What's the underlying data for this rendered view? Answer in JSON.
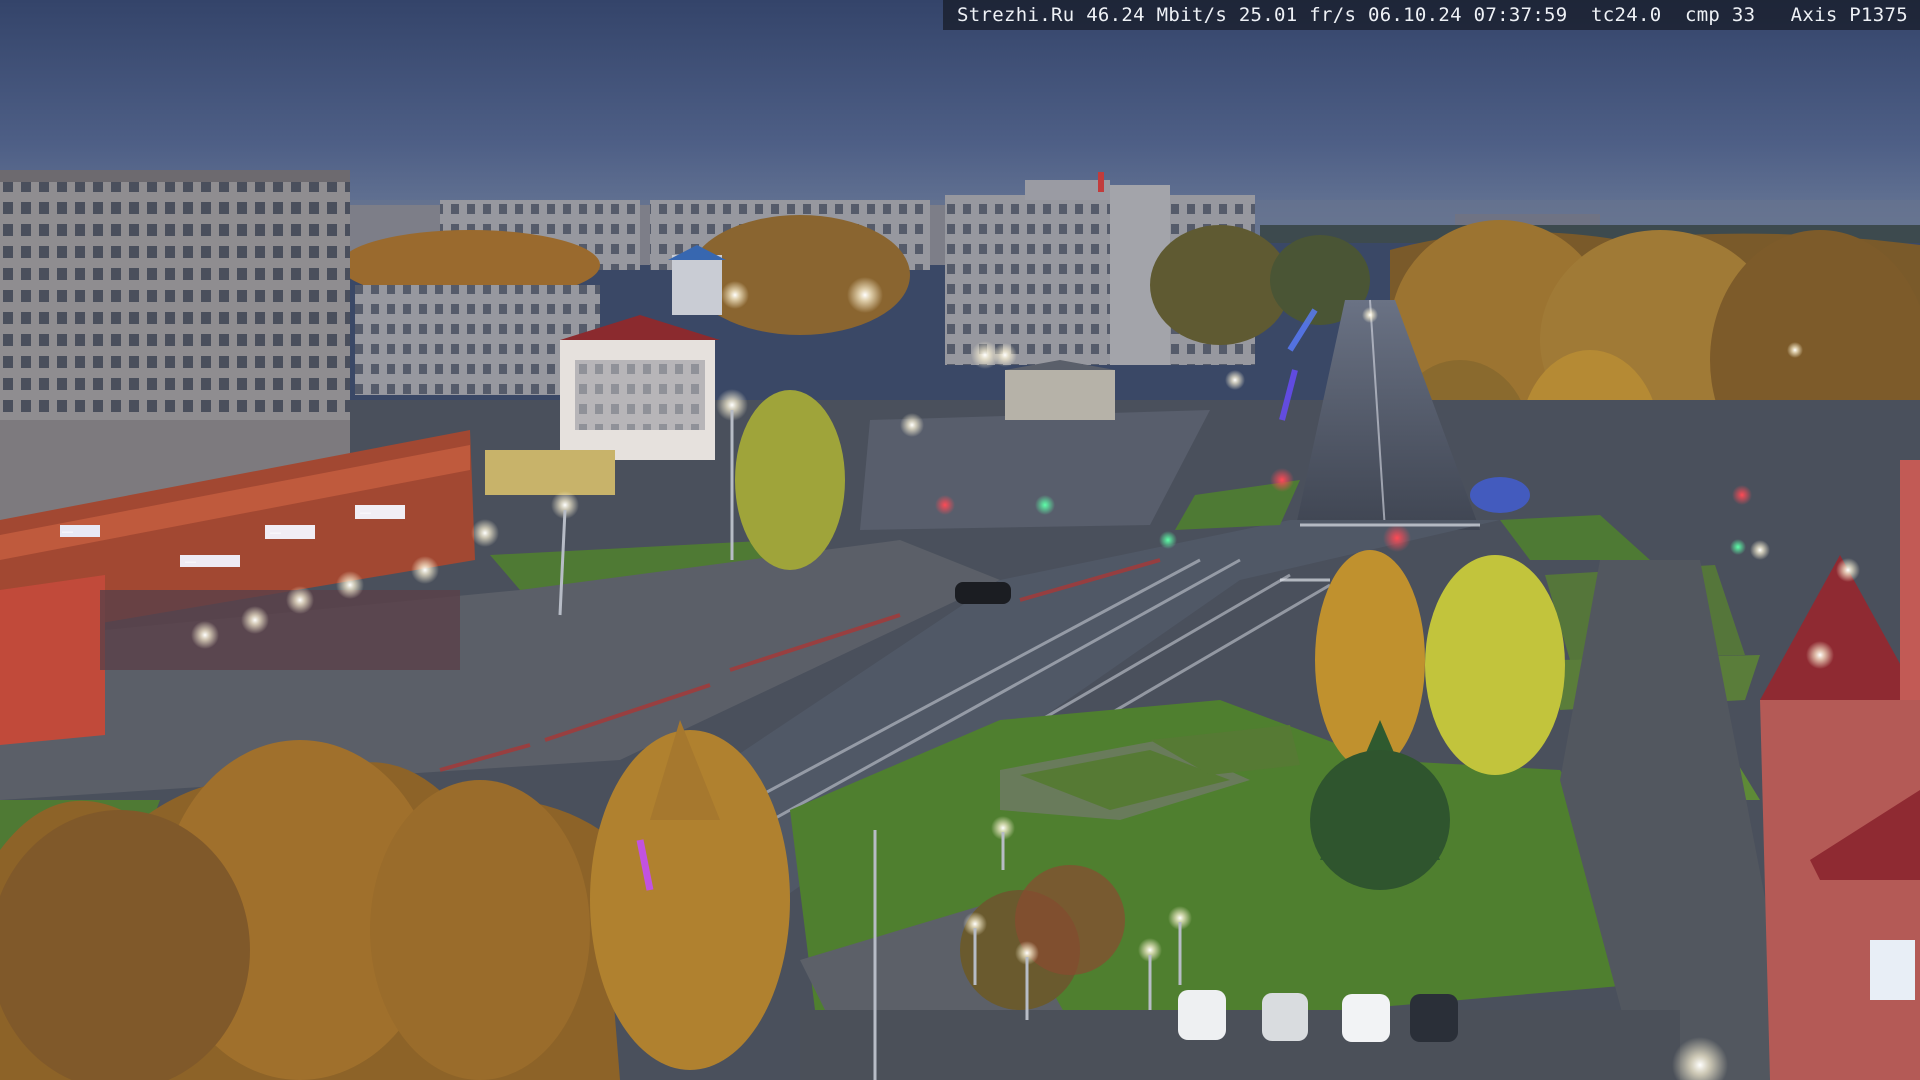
{
  "camera_overlay": {
    "source": "Strezhi.Ru",
    "bitrate": "46.24 Mbit/s",
    "framerate": "25.01 fr/s",
    "date": "06.10.24",
    "time": "07:37:59",
    "tc": "tc24.0",
    "cmp": "cmp 33",
    "camera_model": "Axis P1375"
  },
  "storefront_signs": {
    "sign_1": "—",
    "sign_2": "—",
    "sign_3": "—",
    "sign_4": "—"
  },
  "colors": {
    "sky_top": "#3b4a6b",
    "sky_bottom": "#5f7196",
    "asphalt": "#4b5260",
    "grass": "#3f6b2f",
    "foliage_autumn": "#b8872f",
    "foliage_yellow": "#c8c93a",
    "building_panel": "#8d8b8e",
    "building_brick": "#a04a36",
    "streetlight": "#fffbe8",
    "traffic_red": "#ff2b3a",
    "traffic_green": "#28ff8a"
  }
}
